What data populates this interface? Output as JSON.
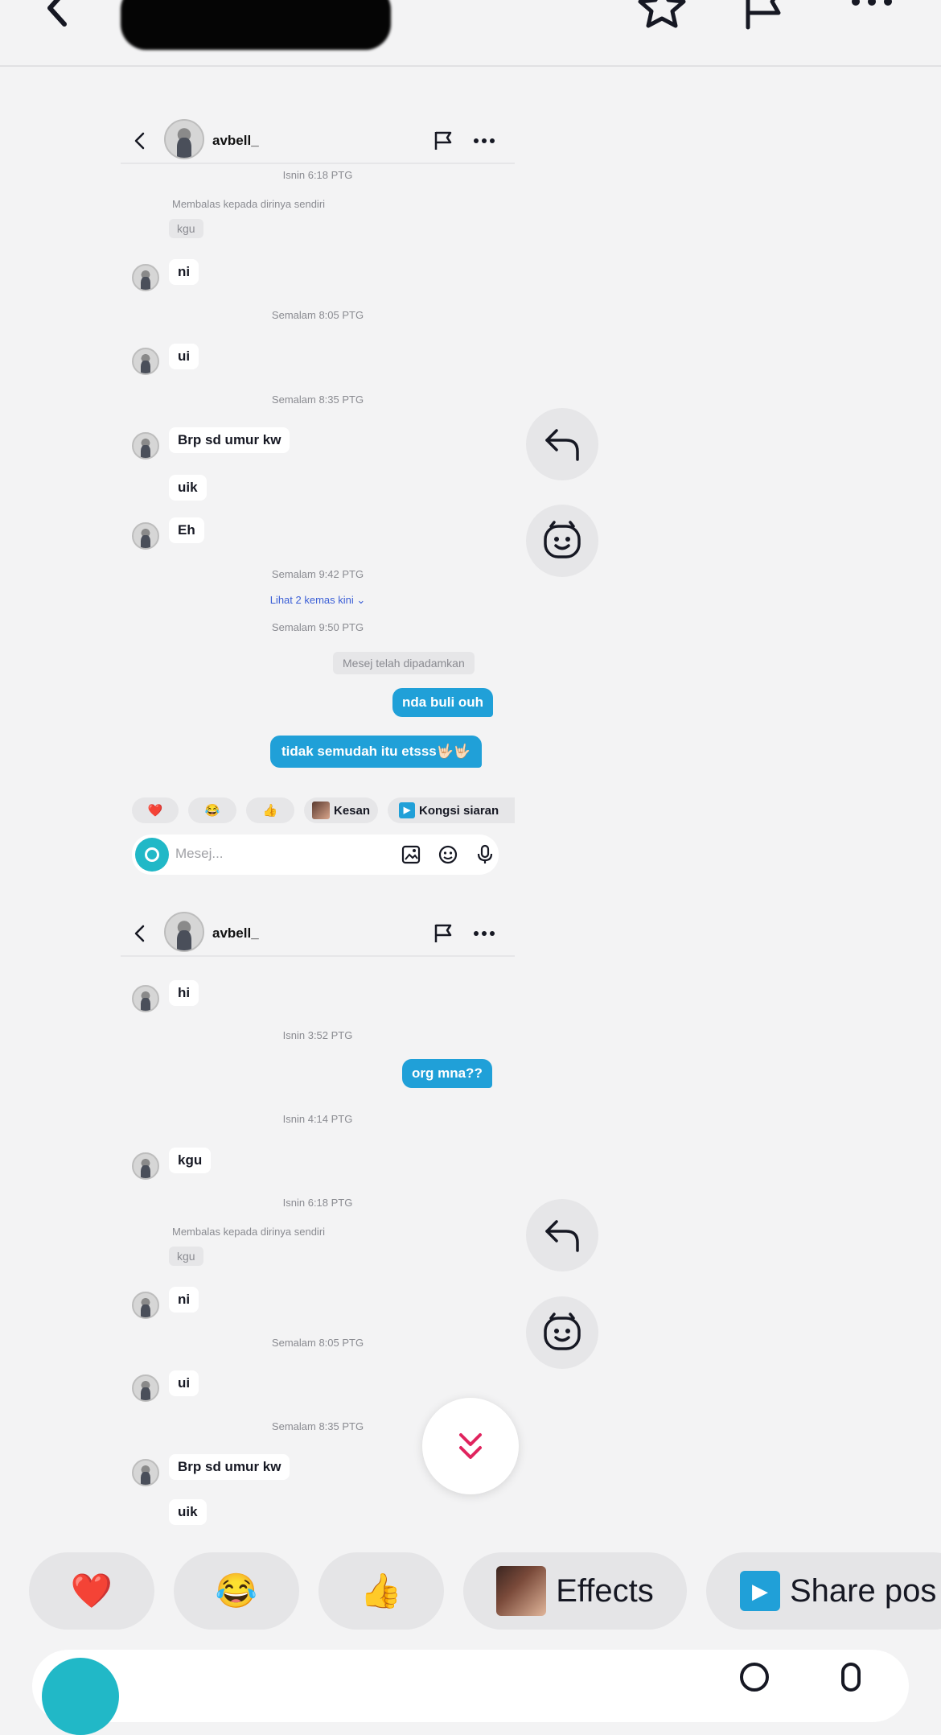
{
  "topbar": {
    "icons": [
      "back-icon",
      "star-icon",
      "flag-icon",
      "more-icon"
    ]
  },
  "shot1": {
    "username": "avbell_",
    "items": {
      "ts1": "Isnin 6:18 PTG",
      "reply_note": "Membalas kepada dirinya sendiri",
      "quoted": "kgu",
      "m_ni": "ni",
      "ts2": "Semalam 8:05 PTG",
      "m_ui": "ui",
      "ts3": "Semalam 8:35 PTG",
      "m_brp": "Brp sd umur kw",
      "m_uik": "uik",
      "m_eh": "Eh",
      "ts4": "Semalam 9:42 PTG",
      "link": "Lihat 2 kemas kini",
      "ts5": "Semalam 9:50 PTG",
      "deleted": "Mesej telah dipadamkan",
      "out1": "nda buli ouh",
      "out2": "tidak semudah itu etsss🤟🏻🤟🏻"
    },
    "chips": [
      "❤️",
      "😂",
      "👍",
      "Kesan",
      "Kongsi siaran"
    ],
    "input_placeholder": "Mesej..."
  },
  "shot2": {
    "username": "avbell_",
    "items": {
      "m_hi": "hi",
      "ts1": "Isnin 3:52 PTG",
      "out1": "org mna??",
      "ts2": "Isnin 4:14 PTG",
      "m_kgu": "kgu",
      "ts3": "Isnin 6:18 PTG",
      "reply_note": "Membalas kepada dirinya sendiri",
      "quoted": "kgu",
      "m_ni": "ni",
      "ts4": "Semalam 8:05 PTG",
      "m_ui": "ui",
      "ts5": "Semalam 8:35 PTG",
      "m_brp": "Brp sd umur kw",
      "m_uik": "uik"
    }
  },
  "reactions": {
    "heart": "❤️",
    "laugh": "😂",
    "thumbs": "👍",
    "effects": "Effects",
    "share": "Share pos"
  },
  "colors": {
    "accent_blue": "#20a0d8",
    "accent_pink": "#fe2c55",
    "teal": "#21b8c7"
  }
}
